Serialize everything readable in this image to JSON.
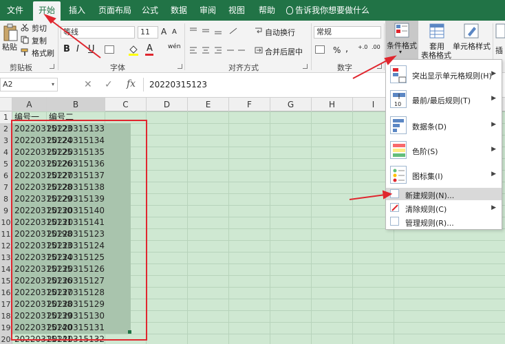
{
  "tabs": [
    "文件",
    "开始",
    "插入",
    "页面布局",
    "公式",
    "数据",
    "审阅",
    "视图",
    "帮助"
  ],
  "tell_me": "告诉我你想要做什么",
  "clipboard": {
    "paste": "粘贴",
    "cut": "剪切",
    "copy": "复制",
    "format_painter": "格式刷",
    "label": "剪贴板"
  },
  "font": {
    "name": "等线",
    "size": "11",
    "bold": "B",
    "italic": "I",
    "underline": "U",
    "font_color": "A",
    "wen": "wén",
    "label": "字体",
    "grow": "A",
    "shrink": "A"
  },
  "alignment": {
    "wrap": "自动换行",
    "merge": "合并后居中",
    "label": "对齐方式"
  },
  "number": {
    "format": "常规",
    "label": "数字",
    "percent": "%",
    "comma": ",",
    "inc": "+.0",
    "dec": ".00"
  },
  "styles": {
    "conditional": "条件格式",
    "table": [
      "套用",
      "表格格式"
    ],
    "cell_styles": "单元格样式",
    "insert": "插",
    "delete": "插"
  },
  "formula_bar": {
    "name_box": "A2",
    "fx": "fx",
    "value": "20220315123"
  },
  "columns": [
    "A",
    "B",
    "C",
    "D",
    "E",
    "F",
    "G",
    "H",
    "I"
  ],
  "rows": [
    "1",
    "2",
    "3",
    "4",
    "5",
    "6",
    "7",
    "8",
    "9",
    "10",
    "11",
    "12",
    "13",
    "14",
    "15",
    "16",
    "17",
    "18",
    "19",
    "20",
    "21"
  ],
  "headers": [
    "编号一",
    "编号二"
  ],
  "col_a": [
    "20220315123",
    "20220315124",
    "20220315125",
    "20220315126",
    "20220315127",
    "20220315128",
    "20220315129",
    "20220315130",
    "20220315131",
    "20220315198",
    "20220315133",
    "20220315134",
    "20220315135",
    "20220315136",
    "20220315137",
    "20220315138",
    "20220315139",
    "20220315140",
    "20220315141"
  ],
  "col_b": [
    "20220315133",
    "20220315134",
    "20220315135",
    "20220315136",
    "20220315137",
    "20220315138",
    "20220315139",
    "20220315140",
    "20220315141",
    "20220315123",
    "20220315124",
    "20220315125",
    "20220315126",
    "20220315127",
    "20220315128",
    "20220315129",
    "20220315130",
    "20220315131",
    "20220315132"
  ],
  "menu": {
    "highlight": "突出显示单元格规则(H)",
    "topbottom": "最前/最后规则(T)",
    "topbottom_icon": "10",
    "databars": "数据条(D)",
    "colorscales": "色阶(S)",
    "iconsets": "图标集(I)",
    "new_rule": "新建规则(N)...",
    "clear_rules": "清除规则(C)",
    "manage_rules": "管理规则(R)..."
  },
  "colors": {
    "ribbon_green": "#217346",
    "sheet_bg": "#cfe8d2",
    "annotation_red": "#e0262e"
  }
}
